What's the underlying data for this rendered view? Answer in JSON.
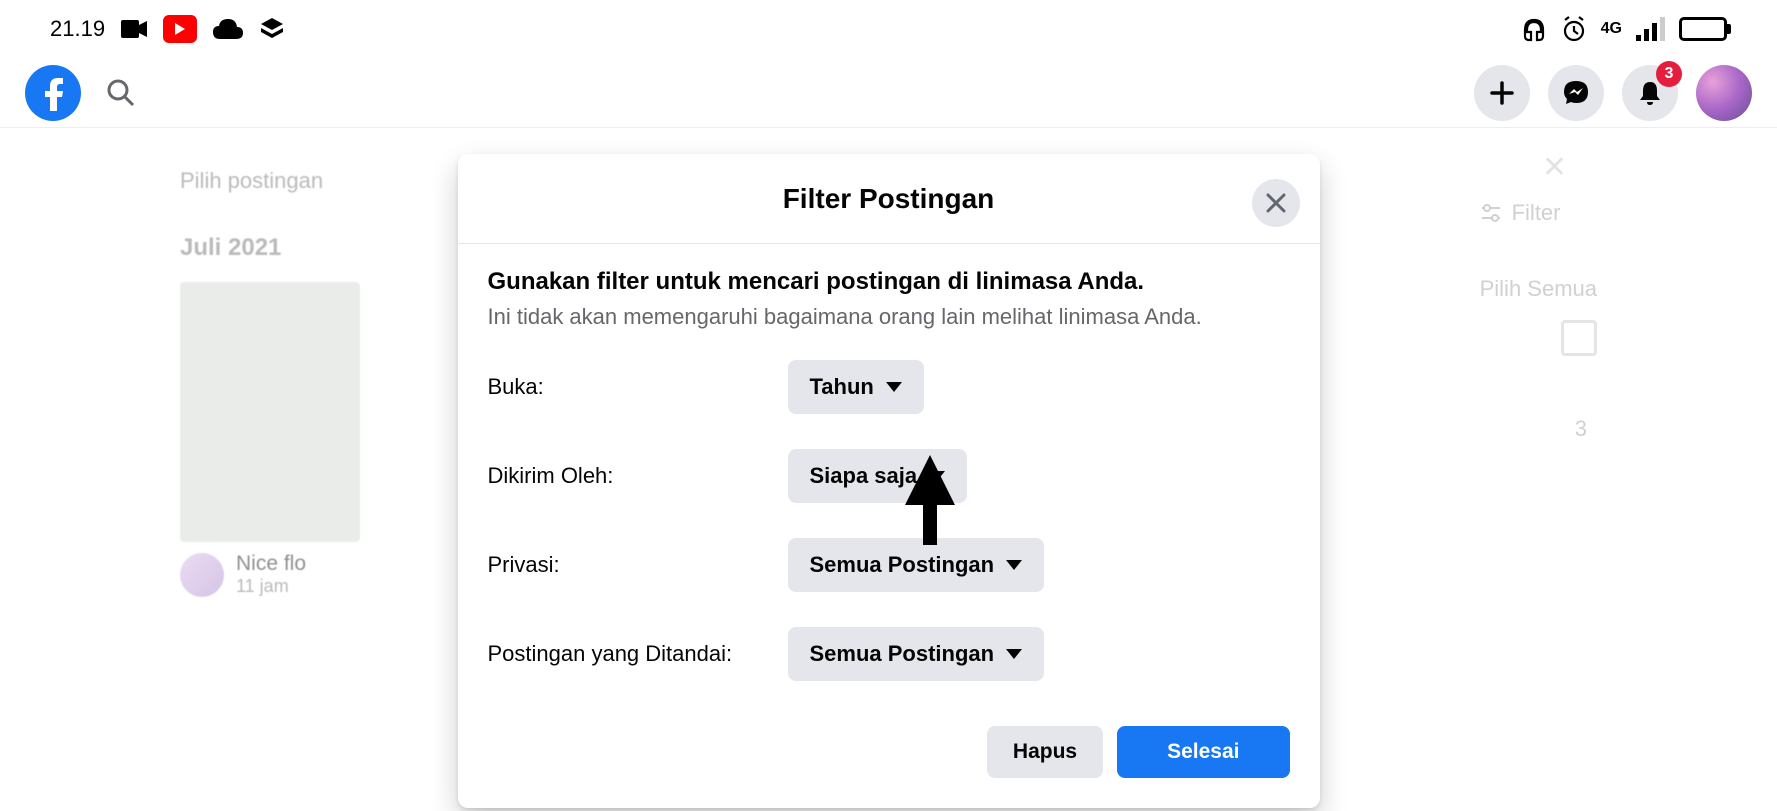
{
  "status_bar": {
    "time": "21.19",
    "network": "4G"
  },
  "header": {
    "notifications_badge": "3"
  },
  "background": {
    "pilih_postingan": "Pilih postingan",
    "date_header": "Juli 2021",
    "comment_name": "Nice flo",
    "comment_time": "11 jam",
    "filter_link": "Filter",
    "select_all": "Pilih Semua",
    "count": "3"
  },
  "modal": {
    "title": "Filter Postingan",
    "heading": "Gunakan filter untuk mencari postingan di linimasa Anda.",
    "subheading": "Ini tidak akan memengaruhi bagaimana orang lain melihat linimasa Anda.",
    "rows": [
      {
        "label": "Buka:",
        "value": "Tahun"
      },
      {
        "label": "Dikirim Oleh:",
        "value": "Siapa saja"
      },
      {
        "label": "Privasi:",
        "value": "Semua Postingan"
      },
      {
        "label": "Postingan yang Ditandai:",
        "value": "Semua Postingan"
      }
    ],
    "button_clear": "Hapus",
    "button_done": "Selesai"
  }
}
